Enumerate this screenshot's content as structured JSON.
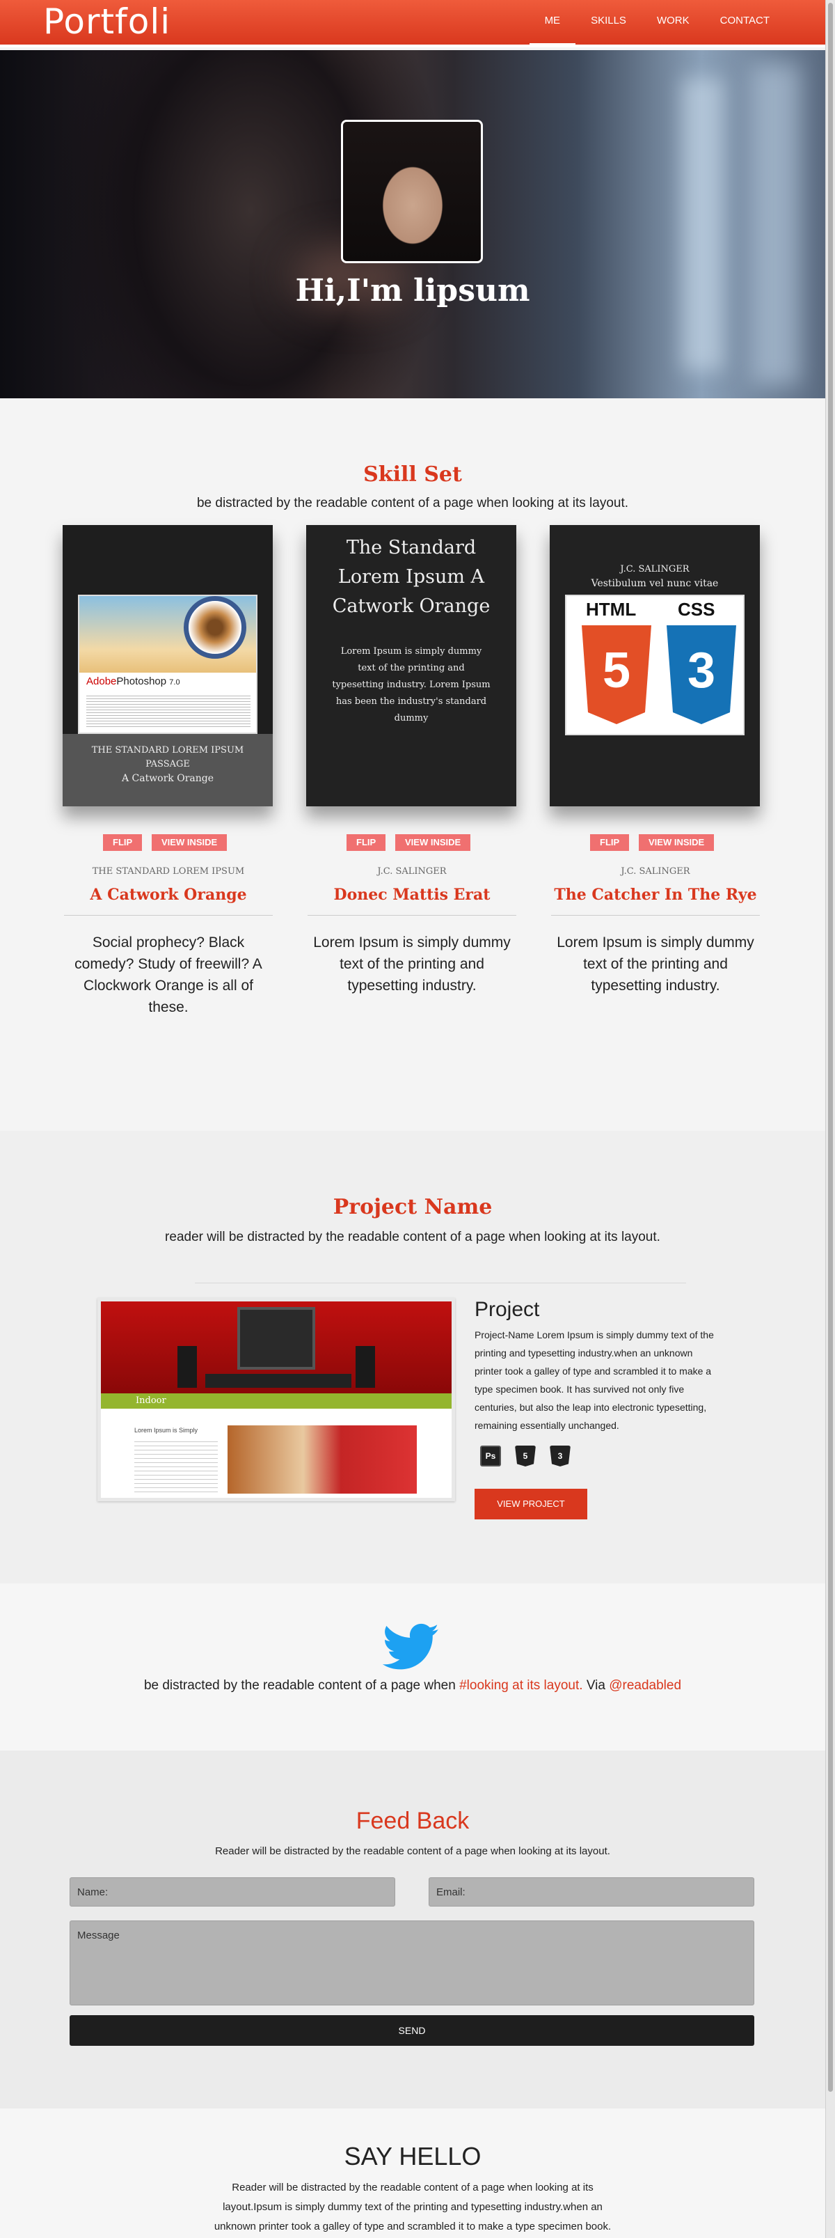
{
  "brand": "Portfoli",
  "nav": {
    "items": [
      "ME",
      "SKILLS",
      "WORK",
      "CONTACT"
    ],
    "active": "ME"
  },
  "hero": {
    "title": "Hi,I'm lipsum"
  },
  "skills": {
    "title": "Skill Set",
    "subtitle": "be distracted by the readable content of a page when looking at its layout.",
    "books": [
      {
        "cover_bottom_line1": "THE STANDARD LOREM IPSUM",
        "cover_bottom_line2": "PASSAGE",
        "cover_bottom_line3": "A Catwork Orange",
        "cover_img_brand": "Adobe",
        "cover_img_product": "Photoshop",
        "cover_img_version": "7.0",
        "flip": "FLIP",
        "inside": "VIEW INSIDE",
        "author": "THE STANDARD LOREM IPSUM",
        "name": "A Catwork Orange",
        "desc": "Social prophecy? Black comedy? Study of freewill? A Clockwork Orange is all of these."
      },
      {
        "cover_title": "The Standard Lorem Ipsum A Catwork Orange",
        "cover_body": "Lorem Ipsum is simply dummy text of the printing and typesetting industry. Lorem Ipsum has been the industry's standard dummy",
        "flip": "FLIP",
        "inside": "VIEW INSIDE",
        "author": "J.C. SALINGER",
        "name": "Donec Mattis Erat",
        "desc": "Lorem Ipsum is simply dummy text of the printing and typesetting industry."
      },
      {
        "cover_author": "J.C. SALINGER",
        "cover_line": "Vestibulum vel nunc vitae",
        "cover_html": "HTML",
        "cover_css": "CSS",
        "cover_html_num": "5",
        "cover_css_num": "3",
        "flip": "FLIP",
        "inside": "VIEW INSIDE",
        "author": "J.C. SALINGER",
        "name": "The Catcher In The Rye",
        "desc": "Lorem Ipsum is simply dummy text of the printing and typesetting industry."
      }
    ]
  },
  "project": {
    "title": "Project Name",
    "subtitle": "reader will be distracted by the readable content of a page when looking at its layout.",
    "heading": "Project",
    "text": "Project-Name Lorem Ipsum is simply dummy text of the printing and typesetting industry.when an unknown printer took a galley of type and scrambled it to make a type specimen book. It has survived not only five centuries, but also the leap into electronic typesetting, remaining essentially unchanged.",
    "icons": [
      "Ps",
      "5",
      "3"
    ],
    "button": "VIEW PROJECT",
    "thumb_brand": "Indoor",
    "thumb_heading": "Lorem Ipsum is Simply"
  },
  "twitter": {
    "text": "be distracted by the readable content of a page when",
    "hashtag": "#looking at its layout.",
    "via": "Via",
    "handle": "@readabled"
  },
  "feedback": {
    "title": "Feed Back",
    "subtitle": "Reader will be distracted by the readable content of a page when looking at its layout.",
    "name_placeholder": "Name:",
    "email_placeholder": "Email:",
    "message_placeholder": "Message",
    "send": "SEND"
  },
  "hello": {
    "title": "SAY HELLO",
    "text": "Reader will be distracted by the readable content of a page when looking at its layout.Ipsum is simply dummy text of the printing and typesetting industry.when an unknown printer took a galley of type and scrambled it to make a type specimen book."
  },
  "colors": {
    "accent": "#d9381e",
    "button_pink": "#f07070",
    "dark": "#1e1e1e"
  }
}
